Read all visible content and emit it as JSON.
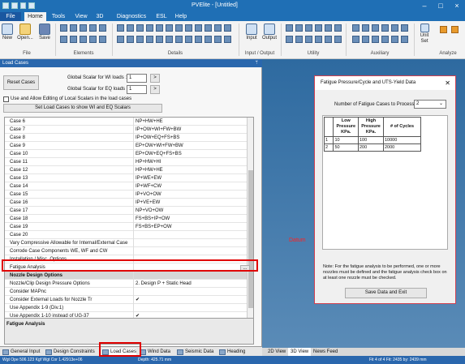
{
  "window": {
    "title": "PVElite - [Untitled]"
  },
  "menu_tabs": [
    "File",
    "Home",
    "Tools",
    "View",
    "3D",
    "Diagnostics",
    "ESL",
    "Help"
  ],
  "ribbon": {
    "buttons": {
      "new": "New",
      "open": "Open...",
      "save": "Save",
      "input": "Input",
      "output": "Output",
      "units": "Unit",
      "set_defaults": "Set"
    },
    "groups": [
      "File",
      "Elements",
      "Details",
      "Input / Output",
      "Utility",
      "Auxiliary",
      "Analyze"
    ]
  },
  "panel": {
    "title": "Load Cases",
    "pin": "ᛘ",
    "reset_button": "Reset Cases",
    "wi_label": "Global Scalar for WI loads :",
    "wi_value": "1",
    "eq_label": "Global Scalar for EQ loads :",
    "eq_value": "1",
    "arrow": ">",
    "allow_label": "Use and Allow Editing of Local Scalars in the load cases",
    "set_button": "Set Load Cases to show WI and EQ Scalars",
    "ellipsis": "...",
    "checkmark": "✔",
    "description_title": "Fatigue Analysis"
  },
  "grid_rows": [
    {
      "name": "Case 6",
      "value": "NP+HW+HE"
    },
    {
      "name": "Case 7",
      "value": "IP+OW+WI+FW+BW"
    },
    {
      "name": "Case 8",
      "value": "IP+OW+EQ+FS+BS"
    },
    {
      "name": "Case 9",
      "value": "EP+OW+WI+FW+BW"
    },
    {
      "name": "Case 10",
      "value": "EP+OW+EQ+FS+BS"
    },
    {
      "name": "Case 11",
      "value": "HP+HW+HI"
    },
    {
      "name": "Case 12",
      "value": "HP+HW+HE"
    },
    {
      "name": "Case 13",
      "value": "IP+WE+EW"
    },
    {
      "name": "Case 14",
      "value": "IP+WF+CW"
    },
    {
      "name": "Case 15",
      "value": "IP+VO+OW"
    },
    {
      "name": "Case 16",
      "value": "IP+VE+EW"
    },
    {
      "name": "Case 17",
      "value": "NP+VO+OW"
    },
    {
      "name": "Case 18",
      "value": "FS+BS+IP+OW"
    },
    {
      "name": "Case 19",
      "value": "FS+BS+EP+OW"
    },
    {
      "name": "Case 20",
      "value": ""
    },
    {
      "name": "Vary Compressive Allowable for Internal/External Case",
      "value": ""
    },
    {
      "name": "Corrode Case Components WE, WF and CW",
      "value": ""
    },
    {
      "name": "Installation / Misc. Options",
      "value": ""
    },
    {
      "name": "Fatigue Analysis",
      "value": ""
    },
    {
      "name": "Nozzle Design Options",
      "value": ""
    },
    {
      "name": "Nozzle/Clip Design Pressure Options",
      "value": "2. Design P + Static Head"
    },
    {
      "name": "Consider MAPnc",
      "value": ""
    },
    {
      "name": "Consider External Loads for Nozzle Tr",
      "value": "✔"
    },
    {
      "name": "Use Appendix 1-9 (Div.1)",
      "value": ""
    },
    {
      "name": "Use Appendix 1-10 instead of UG-37",
      "value": "✔"
    }
  ],
  "bottom_tabs": [
    "General Input",
    "Design Constraints",
    "Load Cases",
    "Wind Data",
    "Seismic Data",
    "Heading"
  ],
  "view_tabs": [
    "2D View",
    "3D View",
    "News Feed"
  ],
  "datum_label": "Datum",
  "statusbar": {
    "left": "Wgt Ope 506.123 Kgf  Wgt Cor 1.42913e+06",
    "mid": "Depth: 425.71 mm",
    "right": "Fit 4 of 4   Fit: 2435 by: 2439 mm"
  },
  "dialog": {
    "title": "Fatigue Pressure/Cycle and UTS-Yield Data",
    "close": "✕",
    "num_label": "Number of Fatigue Cases to Process :",
    "num_value": "2",
    "headers": [
      "Low Pressure KPa.",
      "High Pressure KPa.",
      "# of Cycles"
    ],
    "rows": [
      {
        "index": "1",
        "low": "10",
        "high": "100",
        "cycles": "10000"
      },
      {
        "index": "2",
        "low": "50",
        "high": "200",
        "cycles": "2000"
      }
    ],
    "note": "Note: For the fatigue analysis to be performed, one or more nozzles must be defined and the fatigue analysis check box on at least one nozzle must be checked.",
    "save_button": "Save Data and Exit"
  },
  "colors": {
    "title_blue": "#1f6fb5",
    "highlight_red": "#e00000",
    "datum_red": "#ff2020"
  }
}
